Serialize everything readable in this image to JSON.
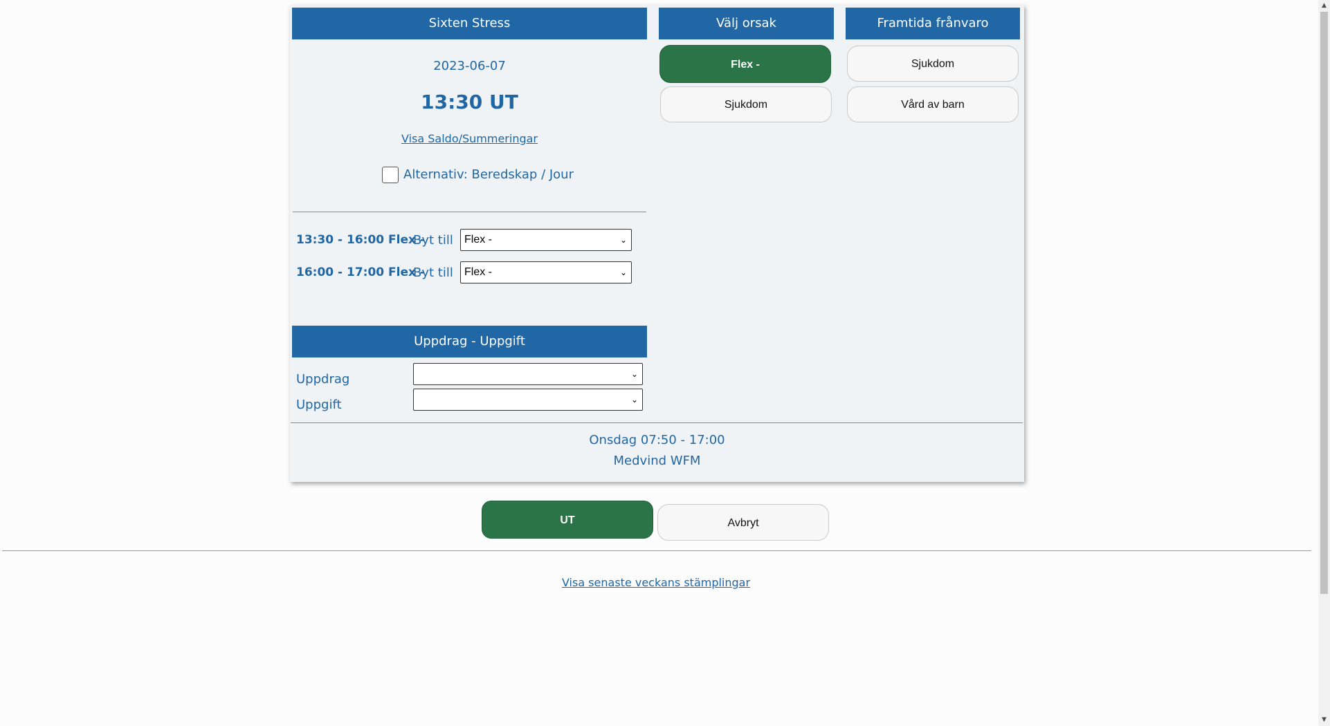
{
  "employee": {
    "name": "Sixten Stress",
    "date": "2023-06-07",
    "time_status": "13:30 UT",
    "saldo_link": "Visa Saldo/Summeringar",
    "alt_label": "Alternativ: Beredskap / Jour"
  },
  "intervals": [
    {
      "label": "13:30 - 16:00 Flex -",
      "switch_label": "Byt till",
      "selected": "Flex -"
    },
    {
      "label": "16:00 - 17:00 Flex -",
      "switch_label": "Byt till",
      "selected": "Flex -"
    }
  ],
  "assignment": {
    "header": "Uppdrag - Uppgift",
    "uppdrag_label": "Uppdrag",
    "uppdrag_value": "",
    "uppgift_label": "Uppgift",
    "uppgift_value": ""
  },
  "reasons": {
    "header": "Välj orsak",
    "items": [
      {
        "label": "Flex -",
        "selected": true
      },
      {
        "label": "Sjukdom",
        "selected": false
      }
    ]
  },
  "future": {
    "header": "Framtida frånvaro",
    "items": [
      {
        "label": "Sjukdom"
      },
      {
        "label": "Vård av barn"
      }
    ]
  },
  "footer": {
    "schedule": "Onsdag 07:50 - 17:00",
    "app_name": "Medvind WFM"
  },
  "actions": {
    "ut_label": "UT",
    "cancel_label": "Avbryt"
  },
  "week_link": "Visa senaste veckans stämplingar",
  "colors": {
    "header_blue": "#2166a5",
    "text_blue": "#1f66a3",
    "green": "#2b7447",
    "panel_bg": "#f0f3f6"
  }
}
